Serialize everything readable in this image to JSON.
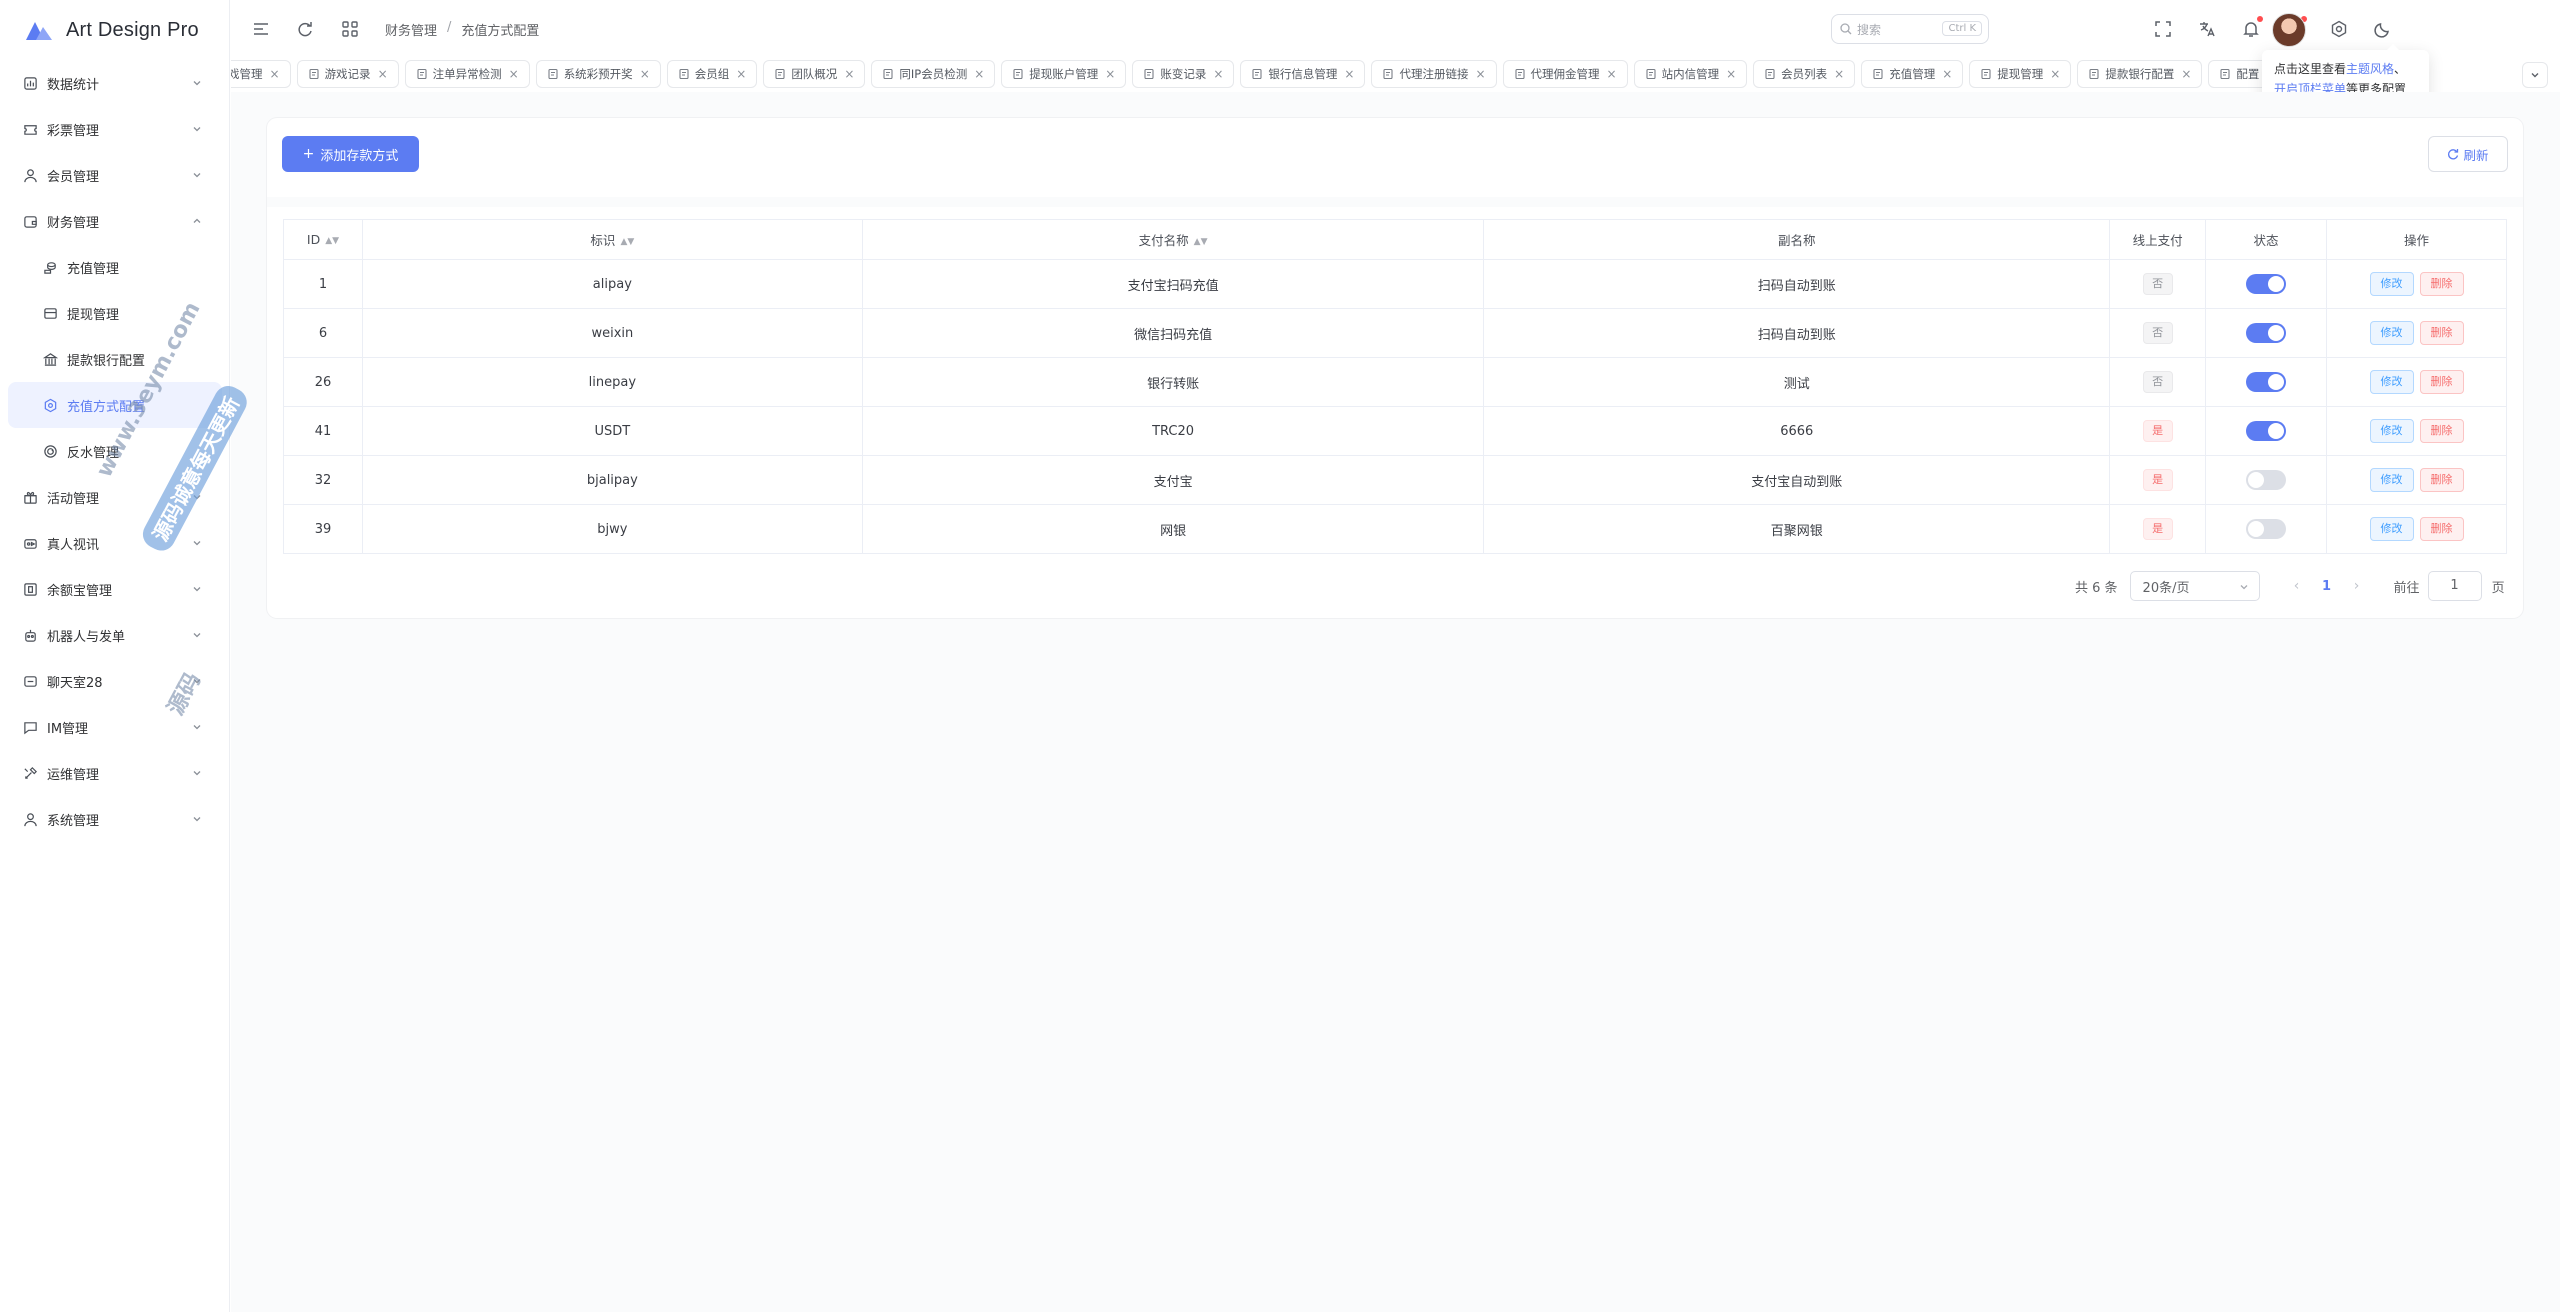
{
  "app": {
    "title": "Art Design Pro"
  },
  "sidebar": {
    "items": [
      {
        "label": "数据统计",
        "icon": "chart-icon",
        "chevron": "down"
      },
      {
        "label": "彩票管理",
        "icon": "ticket-icon",
        "chevron": "down"
      },
      {
        "label": "会员管理",
        "icon": "user-icon",
        "chevron": "down"
      },
      {
        "label": "财务管理",
        "icon": "wallet-icon",
        "chevron": "up"
      },
      {
        "label": "充值管理",
        "icon": "coins-icon",
        "sub": true
      },
      {
        "label": "提现管理",
        "icon": "card-icon",
        "sub": true
      },
      {
        "label": "提款银行配置",
        "icon": "bank-icon",
        "sub": true
      },
      {
        "label": "充值方式配置",
        "icon": "settings-icon",
        "sub": true,
        "active": true
      },
      {
        "label": "反水管理",
        "icon": "rebate-icon",
        "sub": true
      },
      {
        "label": "活动管理",
        "icon": "gift-icon",
        "chevron": "down"
      },
      {
        "label": "真人视讯",
        "icon": "video-icon",
        "chevron": "down"
      },
      {
        "label": "余额宝管理",
        "icon": "safe-icon",
        "chevron": "down"
      },
      {
        "label": "机器人与发单",
        "icon": "robot-icon",
        "chevron": "down"
      },
      {
        "label": "聊天室28",
        "icon": "chat-icon",
        "chevron": "down"
      },
      {
        "label": "IM管理",
        "icon": "message-icon",
        "chevron": "down"
      },
      {
        "label": "运维管理",
        "icon": "tools-icon",
        "chevron": "down"
      },
      {
        "label": "系统管理",
        "icon": "user-icon",
        "chevron": "down"
      }
    ]
  },
  "header": {
    "breadcrumb": [
      "财务管理",
      "充值方式配置"
    ],
    "search_placeholder": "搜索",
    "search_kbd": "Ctrl K"
  },
  "tabs": [
    "戏管理",
    "游戏记录",
    "注单异常检测",
    "系统彩预开奖",
    "会员组",
    "团队概况",
    "同IP会员检测",
    "提现账户管理",
    "账变记录",
    "银行信息管理",
    "代理注册链接",
    "代理佣金管理",
    "站内信管理",
    "会员列表",
    "充值管理",
    "提现管理",
    "提款银行配置",
    "配置"
  ],
  "tooltip": {
    "prefix": "点击这里查看",
    "link1": "主题风格",
    "sep": "、",
    "line2_prefix": "开启顶栏菜单",
    "line2_suffix": "等更多配置"
  },
  "toolbar": {
    "add_label": "添加存款方式",
    "refresh_label": "刷新"
  },
  "table": {
    "columns": [
      "ID",
      "标识",
      "支付名称",
      "副名称",
      "线上支付",
      "状态",
      "操作"
    ],
    "rows": [
      {
        "id": "1",
        "code": "alipay",
        "name": "支付宝扫码充值",
        "subname": "扫码自动到账",
        "online": "否",
        "status": "on"
      },
      {
        "id": "6",
        "code": "weixin",
        "name": "微信扫码充值",
        "subname": "扫码自动到账",
        "online": "否",
        "status": "on"
      },
      {
        "id": "26",
        "code": "linepay",
        "name": "银行转账",
        "subname": "测试",
        "online": "否",
        "status": "on"
      },
      {
        "id": "41",
        "code": "USDT",
        "name": "TRC20",
        "subname": "6666",
        "online": "是",
        "status": "on"
      },
      {
        "id": "32",
        "code": "bjalipay",
        "name": "支付宝",
        "subname": "支付宝自动到账",
        "online": "是",
        "status": "off"
      },
      {
        "id": "39",
        "code": "bjwy",
        "name": "网银",
        "subname": "百聚网银",
        "online": "是",
        "status": "off"
      }
    ],
    "edit_label": "修改",
    "delete_label": "删除"
  },
  "pagination": {
    "total": "共 6 条",
    "page_size": "20条/页",
    "current_page": "1",
    "goto_label": "前往",
    "goto_value": "1",
    "unit": "页"
  },
  "watermark": {
    "line1": "www.3eym.com",
    "line2": "源码诚意每天更新",
    "line3": "源码"
  },
  "colors": {
    "accent": "#5c7cf2",
    "danger": "#f56c6c"
  }
}
